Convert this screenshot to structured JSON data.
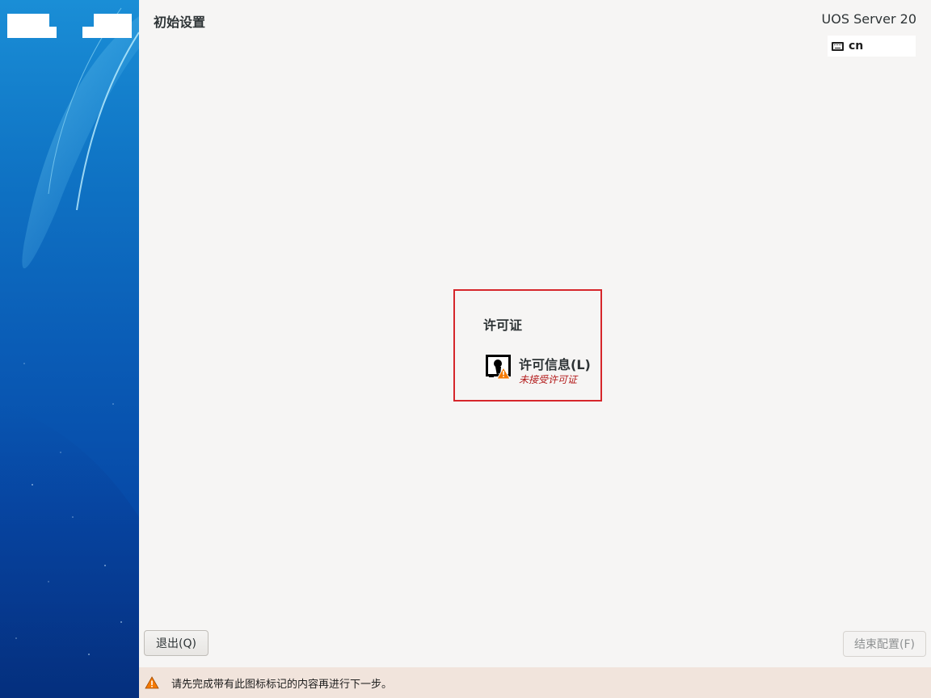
{
  "header": {
    "title": "初始设置",
    "product": "UOS Server 20",
    "keyboard_layout": "cn"
  },
  "hub": {
    "section_title": "许可证",
    "spoke": {
      "title": "许可信息(L)",
      "status": "未接受许可证",
      "icon": "license-document-warning-icon"
    },
    "highlight_color": "#d6262b"
  },
  "buttons": {
    "quit": "退出(Q)",
    "finish": "结束配置(F)"
  },
  "warning": {
    "text": "请先完成带有此图标标记的内容再进行下一步。",
    "icon": "warning-triangle-icon",
    "background": "#f1e4dc"
  },
  "colors": {
    "sidebar_top": "#1a8ed6",
    "sidebar_bottom": "#053b93",
    "warning_orange": "#f57900",
    "status_red": "#b21616"
  }
}
